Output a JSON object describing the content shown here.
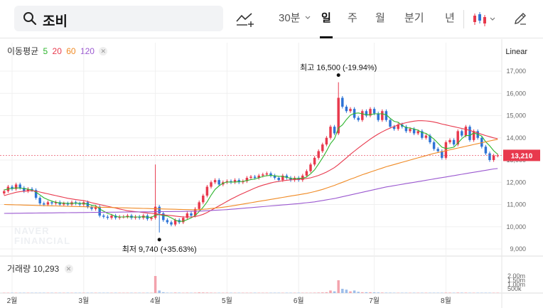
{
  "toolbar": {
    "search_value": "조비",
    "interval": "30분",
    "periods": [
      "일",
      "주",
      "월",
      "분기",
      "년"
    ],
    "active_period": "일"
  },
  "legend": {
    "label": "이동평균",
    "ma": [
      {
        "period": "5",
        "color": "#2db52d"
      },
      {
        "period": "20",
        "color": "#e8394d"
      },
      {
        "period": "60",
        "color": "#f08a24"
      },
      {
        "period": "120",
        "color": "#9b59d0"
      }
    ],
    "scale": "Linear"
  },
  "volume": {
    "label": "거래량",
    "value": "10,293",
    "ticks": [
      "2.00m",
      "1.50m",
      "1.00m",
      "500k"
    ]
  },
  "watermark": [
    "NAVER",
    "FINANCIAL"
  ],
  "chart_data": {
    "type": "candlestick",
    "yticks": [
      "17,000",
      "16,000",
      "15,000",
      "14,000",
      "13,000",
      "12,000",
      "11,000",
      "10,000",
      "9,000"
    ],
    "ylim": [
      9000,
      17500
    ],
    "xticks": [
      "2월",
      "3월",
      "4월",
      "5월",
      "6월",
      "7월",
      "8월"
    ],
    "current_price": "13,210",
    "high_label": "최고 16,500 (-19.94%)",
    "low_label": "최저 9,740 (+35.63%)",
    "high": 16500,
    "low": 9740,
    "closes": [
      11600,
      11800,
      11700,
      11900,
      11750,
      11600,
      11700,
      11650,
      11300,
      11050,
      11000,
      11100,
      11050,
      11100,
      11000,
      11050,
      11000,
      11100,
      11050,
      11000,
      11100,
      10900,
      10800,
      10900,
      10500,
      10450,
      10400,
      10500,
      10400,
      10450,
      10450,
      10500,
      10400,
      10450,
      10400,
      10500,
      10350,
      10400,
      10900,
      10600,
      10300,
      10200,
      10100,
      10300,
      10200,
      10400,
      10600,
      10500,
      10800,
      11100,
      11400,
      11800,
      12000,
      12100,
      11900,
      12000,
      12050,
      12000,
      12100,
      12000,
      12050,
      12200,
      12250,
      12200,
      12300,
      12350,
      12400,
      12300,
      12200,
      12100,
      12300,
      12200,
      12100,
      12200,
      12100,
      12300,
      12500,
      12800,
      13100,
      13400,
      13700,
      14000,
      14500,
      14200,
      15800,
      15400,
      15200,
      15300,
      14900,
      14800,
      15200,
      15000,
      15300,
      15100,
      14800,
      15200,
      14800,
      14500,
      14400,
      14600,
      14500,
      14300,
      14400,
      14200,
      14300,
      14000,
      14100,
      13800,
      13500,
      13400,
      13100,
      13800,
      13900,
      13700,
      14300,
      14100,
      14500,
      13900,
      14300,
      14000,
      13600,
      13300,
      13000,
      13200,
      13210
    ],
    "ma5": [
      11650,
      11700,
      11720,
      11750,
      11740,
      11720,
      11690,
      11650,
      11560,
      11430,
      11300,
      11220,
      11150,
      11100,
      11070,
      11060,
      11050,
      11050,
      11060,
      11050,
      11050,
      11020,
      10970,
      10950,
      10800,
      10700,
      10600,
      10550,
      10460,
      10440,
      10440,
      10450,
      10440,
      10440,
      10440,
      10450,
      10430,
      10420,
      10520,
      10550,
      10500,
      10480,
      10400,
      10300,
      10240,
      10250,
      10320,
      10400,
      10500,
      10680,
      10880,
      11120,
      11420,
      11680,
      11840,
      11960,
      12010,
      12010,
      12010,
      12030,
      12040,
      12080,
      12120,
      12150,
      12200,
      12260,
      12300,
      12310,
      12290,
      12270,
      12260,
      12220,
      12180,
      12160,
      12180,
      12180,
      12240,
      12380,
      12560,
      12820,
      13100,
      13400,
      13740,
      13960,
      14440,
      14580,
      14820,
      15020,
      15100,
      15120,
      15080,
      15040,
      15040,
      15080,
      15080,
      15080,
      15040,
      14880,
      14740,
      14700,
      14560,
      14460,
      14440,
      14400,
      14340,
      14240,
      14200,
      14080,
      13940,
      13760,
      13580,
      13520,
      13540,
      13580,
      13760,
      13960,
      14100,
      14100,
      14220,
      14160,
      14080,
      13820,
      13640,
      13420,
      13260
    ],
    "ma20": [
      11400,
      11450,
      11500,
      11550,
      11580,
      11600,
      11610,
      11620,
      11600,
      11560,
      11520,
      11480,
      11440,
      11400,
      11360,
      11320,
      11280,
      11250,
      11220,
      11200,
      11180,
      11130,
      11080,
      11040,
      11000,
      10960,
      10920,
      10880,
      10840,
      10800,
      10760,
      10720,
      10700,
      10680,
      10660,
      10640,
      10620,
      10600,
      10580,
      10560,
      10540,
      10520,
      10500,
      10480,
      10460,
      10440,
      10440,
      10440,
      10460,
      10500,
      10560,
      10640,
      10740,
      10840,
      10940,
      11040,
      11140,
      11240,
      11330,
      11420,
      11500,
      11580,
      11660,
      11740,
      11810,
      11870,
      11920,
      11970,
      12010,
      12040,
      12070,
      12090,
      12110,
      12120,
      12130,
      12150,
      12170,
      12200,
      12250,
      12310,
      12380,
      12460,
      12560,
      12660,
      12800,
      12950,
      13100,
      13260,
      13400,
      13540,
      13680,
      13810,
      13940,
      14060,
      14170,
      14270,
      14360,
      14440,
      14510,
      14580,
      14640,
      14680,
      14720,
      14750,
      14770,
      14770,
      14760,
      14740,
      14710,
      14670,
      14620,
      14580,
      14540,
      14500,
      14460,
      14420,
      14380,
      14330,
      14280,
      14220,
      14160,
      14100,
      14050,
      14000,
      13960
    ],
    "ma60": [
      11000,
      10995,
      10990,
      10985,
      10980,
      10975,
      10970,
      10965,
      10960,
      10955,
      10950,
      10945,
      10940,
      10935,
      10930,
      10925,
      10920,
      10915,
      10910,
      10905,
      10900,
      10895,
      10890,
      10885,
      10880,
      10875,
      10870,
      10865,
      10860,
      10855,
      10850,
      10845,
      10840,
      10835,
      10830,
      10825,
      10820,
      10815,
      10810,
      10805,
      10800,
      10795,
      10790,
      10785,
      10780,
      10775,
      10770,
      10765,
      10760,
      10770,
      10785,
      10800,
      10820,
      10840,
      10860,
      10880,
      10900,
      10930,
      10960,
      10990,
      11020,
      11050,
      11080,
      11110,
      11140,
      11170,
      11200,
      11230,
      11260,
      11290,
      11320,
      11350,
      11380,
      11410,
      11440,
      11470,
      11500,
      11540,
      11580,
      11630,
      11680,
      11740,
      11800,
      11860,
      11930,
      12000,
      12070,
      12140,
      12200,
      12270,
      12340,
      12400,
      12460,
      12520,
      12580,
      12640,
      12700,
      12750,
      12800,
      12850,
      12900,
      12950,
      13000,
      13050,
      13100,
      13150,
      13200,
      13250,
      13300,
      13340,
      13380,
      13420,
      13460,
      13500,
      13540,
      13580,
      13620,
      13660,
      13700,
      13740,
      13780,
      13820,
      13860,
      13900,
      13930
    ],
    "ma120": [
      10600,
      10602,
      10604,
      10606,
      10608,
      10610,
      10612,
      10614,
      10616,
      10618,
      10620,
      10622,
      10624,
      10626,
      10628,
      10630,
      10632,
      10634,
      10636,
      10638,
      10640,
      10642,
      10644,
      10646,
      10648,
      10650,
      10652,
      10654,
      10656,
      10658,
      10660,
      10662,
      10664,
      10666,
      10668,
      10670,
      10672,
      10674,
      10676,
      10678,
      10680,
      10682,
      10684,
      10686,
      10688,
      10690,
      10692,
      10694,
      10696,
      10700,
      10710,
      10720,
      10730,
      10740,
      10750,
      10760,
      10770,
      10785,
      10800,
      10815,
      10830,
      10845,
      10860,
      10875,
      10890,
      10905,
      10920,
      10935,
      10950,
      10965,
      10980,
      10995,
      11010,
      11025,
      11040,
      11060,
      11080,
      11100,
      11120,
      11150,
      11180,
      11210,
      11240,
      11270,
      11310,
      11350,
      11390,
      11430,
      11470,
      11510,
      11550,
      11590,
      11630,
      11670,
      11710,
      11750,
      11790,
      11820,
      11850,
      11880,
      11910,
      11940,
      11970,
      12000,
      12030,
      12060,
      12090,
      12120,
      12150,
      12180,
      12210,
      12240,
      12270,
      12300,
      12330,
      12360,
      12390,
      12420,
      12450,
      12480,
      12510,
      12540,
      12570,
      12600,
      12620
    ],
    "volumes": [
      0.02,
      0.03,
      0.02,
      0.02,
      0.02,
      0.02,
      0.02,
      0.01,
      0.02,
      0.02,
      0.01,
      0.01,
      0.01,
      0.01,
      0.01,
      0.01,
      0.01,
      0.01,
      0.01,
      0.01,
      0.01,
      0.02,
      0.02,
      0.02,
      0.03,
      0.02,
      0.02,
      0.02,
      0.01,
      0.01,
      0.01,
      0.01,
      0.01,
      0.01,
      0.01,
      0.01,
      0.02,
      0.02,
      2.0,
      0.3,
      0.1,
      0.05,
      0.04,
      0.06,
      0.05,
      0.04,
      0.05,
      0.04,
      0.05,
      0.08,
      0.07,
      0.06,
      0.05,
      0.04,
      0.03,
      0.03,
      0.03,
      0.03,
      0.03,
      0.02,
      0.02,
      0.02,
      0.02,
      0.02,
      0.02,
      0.02,
      0.02,
      0.02,
      0.02,
      0.02,
      0.02,
      0.02,
      0.02,
      0.02,
      0.02,
      0.02,
      0.03,
      0.04,
      0.05,
      0.06,
      0.08,
      0.1,
      0.3,
      0.2,
      1.5,
      0.5,
      0.4,
      0.2,
      0.3,
      0.15,
      0.1,
      0.1,
      0.1,
      0.08,
      0.07,
      0.06,
      0.05,
      0.05,
      0.04,
      0.04,
      0.04,
      0.04,
      0.03,
      0.03,
      0.03,
      0.03,
      0.03,
      0.03,
      0.04,
      0.04,
      0.04,
      0.05,
      0.05,
      0.04,
      0.06,
      0.05,
      0.05,
      0.04,
      0.04,
      0.04,
      0.04,
      0.04,
      0.03,
      0.03,
      0.03
    ]
  },
  "colors": {
    "up": "#e8394d",
    "down": "#2e74d6",
    "grid": "#f0f0f0",
    "price_tag": "#e8394d"
  }
}
